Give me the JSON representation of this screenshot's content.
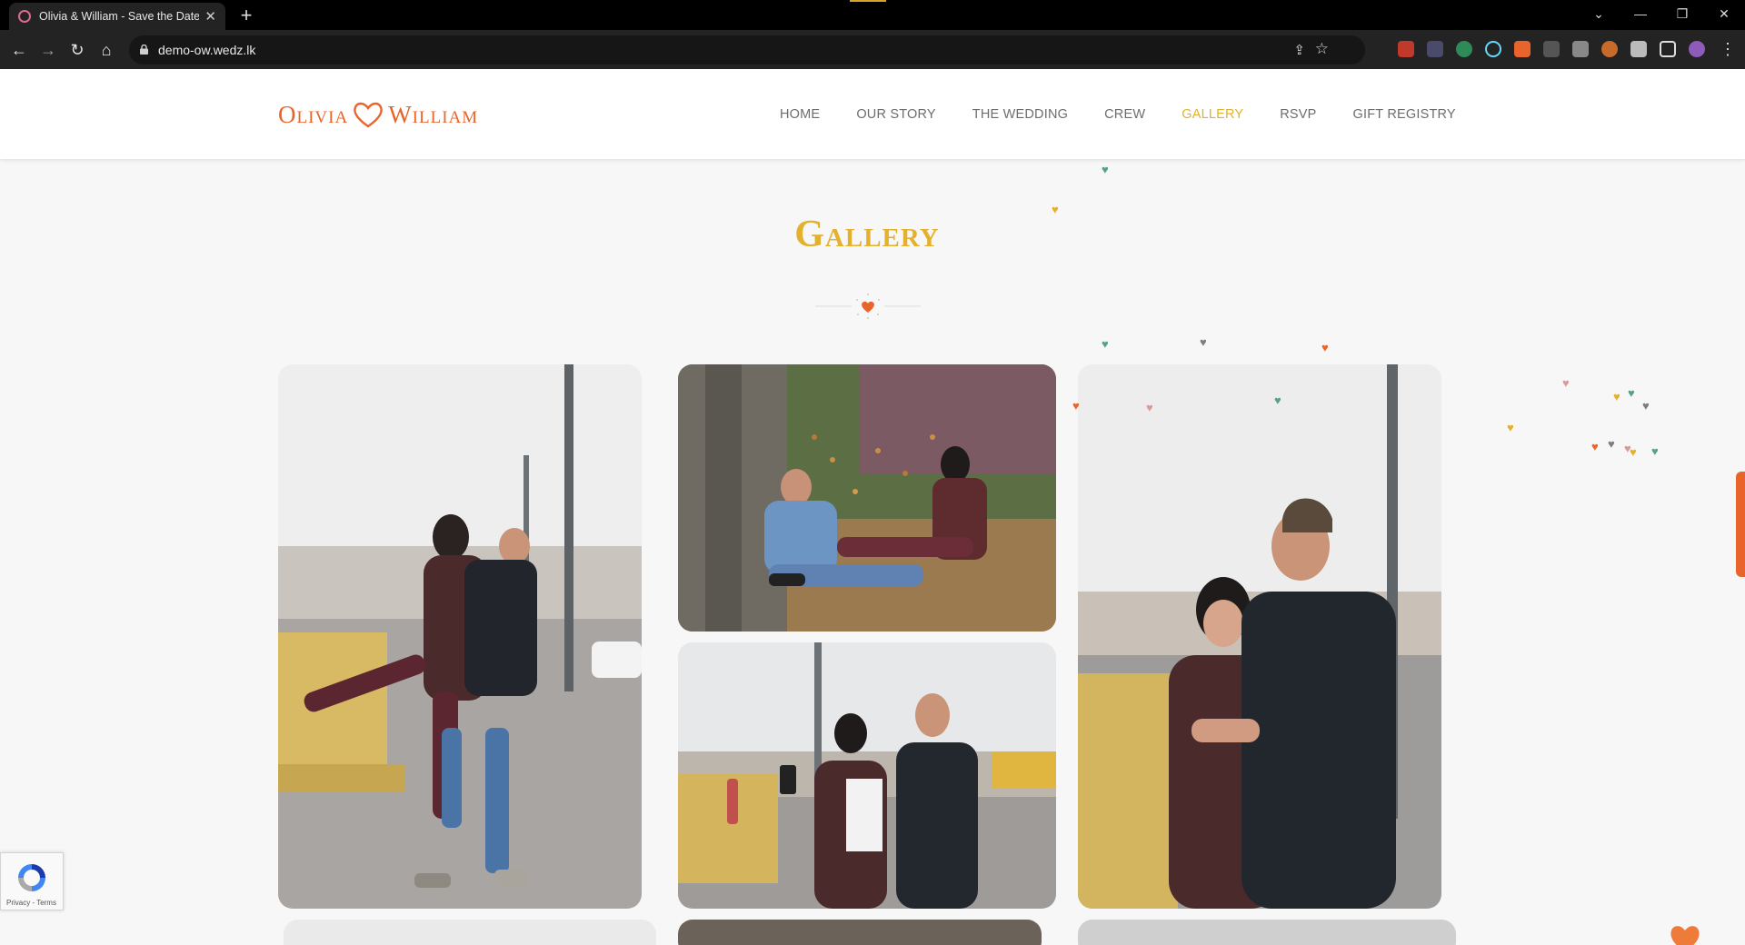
{
  "browser": {
    "tab_title": "Olivia & William - Save the Date",
    "url": "demo-ow.wedz.lk"
  },
  "site": {
    "logo_left": "Olivia",
    "logo_right": "William",
    "nav": [
      {
        "label": "HOME",
        "active": false
      },
      {
        "label": "OUR STORY",
        "active": false
      },
      {
        "label": "THE WEDDING",
        "active": false
      },
      {
        "label": "CREW",
        "active": false
      },
      {
        "label": "GALLERY",
        "active": true
      },
      {
        "label": "RSVP",
        "active": false
      },
      {
        "label": "GIFT REGISTRY",
        "active": false
      }
    ],
    "section_title": "Gallery",
    "colors": {
      "accent_orange": "#e8642a",
      "accent_gold": "#e3b12b",
      "heart_teal": "#5a9e8c",
      "heart_gray": "#7d7d7d",
      "heart_pink": "#d99a9a"
    }
  },
  "recaptcha": {
    "text": "Privacy - Terms"
  }
}
